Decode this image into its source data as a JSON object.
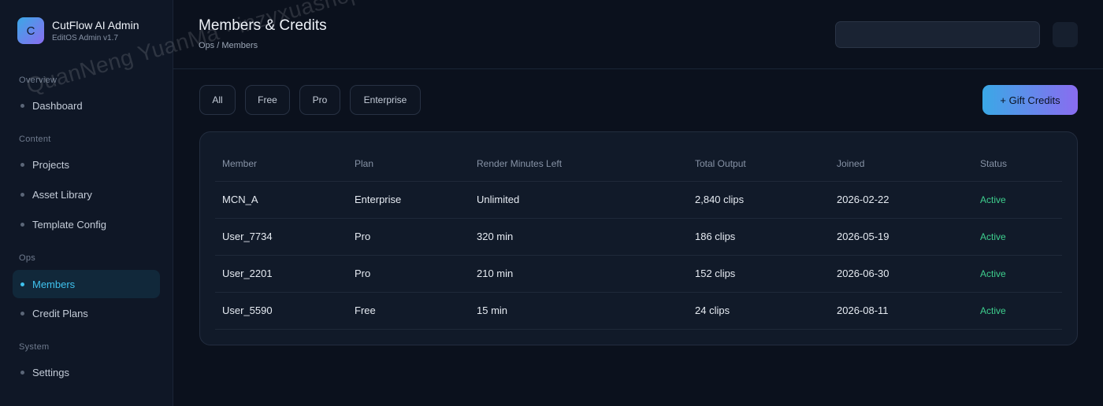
{
  "brand": {
    "logo_letter": "C",
    "name": "CutFlow AI Admin",
    "version": "EditOS Admin v1.7"
  },
  "sidebar": {
    "sections": [
      {
        "label": "Overview",
        "items": [
          "Dashboard"
        ]
      },
      {
        "label": "Content",
        "items": [
          "Projects",
          "Asset Library",
          "Template Config"
        ]
      },
      {
        "label": "Ops",
        "items": [
          "Members",
          "Credit Plans"
        ]
      },
      {
        "label": "System",
        "items": [
          "Settings"
        ]
      }
    ],
    "active_item": "Members"
  },
  "header": {
    "title": "Members & Credits",
    "breadcrumb": "Ops / Members",
    "search_value": ""
  },
  "filters": [
    "All",
    "Free",
    "Pro",
    "Enterprise"
  ],
  "gift_button_label": "+ Gift Credits",
  "table": {
    "columns": [
      "Member",
      "Plan",
      "Render Minutes Left",
      "Total Output",
      "Joined",
      "Status"
    ],
    "rows": [
      [
        "MCN_A",
        "Enterprise",
        "Unlimited",
        "2,840 clips",
        "2026-02-22",
        "Active"
      ],
      [
        "User_7734",
        "Pro",
        "320 min",
        "186 clips",
        "2026-05-19",
        "Active"
      ],
      [
        "User_2201",
        "Pro",
        "210 min",
        "152 clips",
        "2026-06-30",
        "Active"
      ],
      [
        "User_5590",
        "Free",
        "15 min",
        "24 clips",
        "2026-08-11",
        "Active"
      ]
    ]
  },
  "watermark": "QuanNeng YuanMa · inzyxuashop.com",
  "colors": {
    "accent": "#3fc2ee",
    "status_active": "#3ecf8e",
    "gradient_start": "#3aa8e6",
    "gradient_end": "#8a6cf0"
  },
  "icons": {
    "nav_bullet": "dot-icon",
    "header_action": "blank-icon-button"
  }
}
